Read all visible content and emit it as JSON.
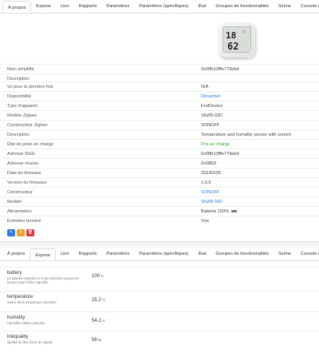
{
  "tabs": [
    "À propos",
    "Expose",
    "Lien",
    "Rapports",
    "Paramètres",
    "Paramètres (spécifiques)",
    "État",
    "Groupes de fonctionnalités",
    "Scène",
    "Console dev"
  ],
  "device_image": {
    "temp": "18",
    "humidity": "62",
    "sub": "°C"
  },
  "properties": [
    {
      "key": "Nom simplifié",
      "value": "0x0ffb10fffe779ebd"
    },
    {
      "key": "Description",
      "value": ""
    },
    {
      "key": "Vu pour la dernière fois",
      "value": "N/A"
    },
    {
      "key": "Disponibilité",
      "value": "Désactivé"
    },
    {
      "key": "Type d'appareil",
      "value": "EndDevice"
    },
    {
      "key": "Modèle Zigbee",
      "value": "SNZB-02D"
    },
    {
      "key": "Constructeur Zigbee",
      "value": "SONOFF"
    },
    {
      "key": "Description",
      "value": "Temperature and humidity sensor with screen"
    },
    {
      "key": "État de prise en charge",
      "value": "Pris en charge"
    },
    {
      "key": "Adresse IEEE",
      "value": "0x0ffb10fffe779ebd"
    },
    {
      "key": "Adresse réseau",
      "value": "0x08E8"
    },
    {
      "key": "Date du firmware",
      "value": "20230105"
    },
    {
      "key": "Version du firmware",
      "value": "1.0.9"
    },
    {
      "key": "Constructeur",
      "value": "SONOFF"
    },
    {
      "key": "Modèle",
      "value": "SNZB-02D"
    },
    {
      "key": "Alimentation",
      "value": "Batterie 100%"
    },
    {
      "key": "Entretien terminé",
      "value": "Vrai"
    }
  ],
  "action_buttons": {
    "edit": "✎",
    "ota": "↻",
    "delete": "🗑"
  },
  "exposes": [
    {
      "name": "battery",
      "desc": "La batterie restante en % peut prendre jusqu'à 24 heures avant d'être signalée",
      "value": "100",
      "unit": "%"
    },
    {
      "name": "temperature",
      "desc": "Valeur de la température mesurée",
      "value": "25.2",
      "unit": "°C"
    },
    {
      "name": "humidity",
      "desc": "Humidité relative mesurée",
      "value": "54.2",
      "unit": "%"
    },
    {
      "name": "linkquality",
      "desc": "Qualité du lien (force du signal)",
      "value": "56",
      "unit": "lqi"
    }
  ],
  "colors": {
    "link": "#1f7fd9",
    "green": "#29a329",
    "blue": "#2c7be5",
    "orange": "#f0a020",
    "red": "#dc3545"
  }
}
